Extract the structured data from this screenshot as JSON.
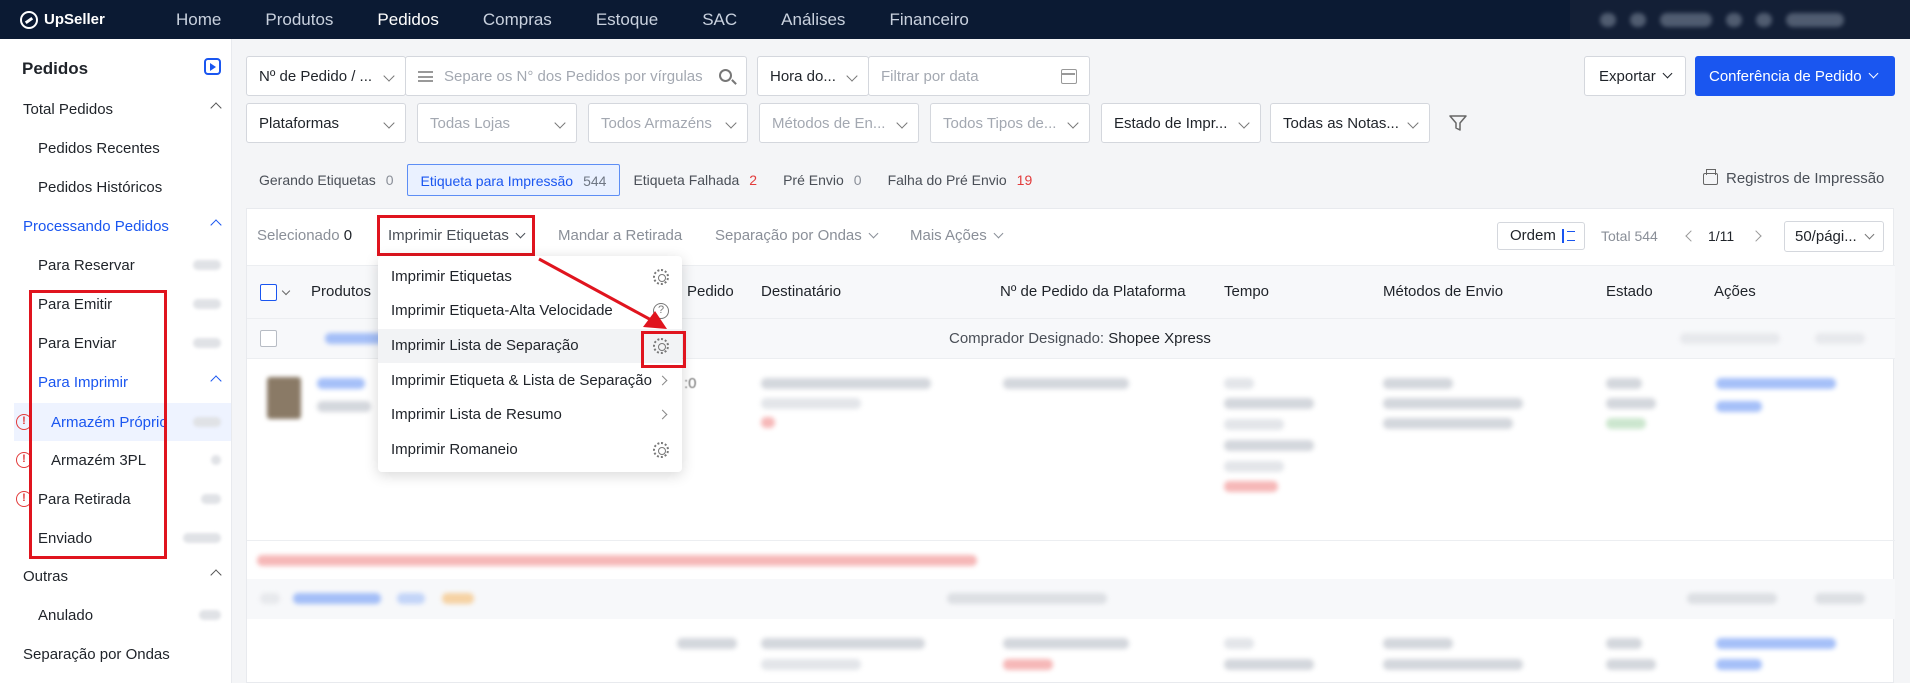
{
  "brand": "UpSeller",
  "nav": [
    "Home",
    "Produtos",
    "Pedidos",
    "Compras",
    "Estoque",
    "SAC",
    "Análises",
    "Financeiro"
  ],
  "sidebar": {
    "title": "Pedidos",
    "items": [
      {
        "label": "Total Pedidos"
      },
      {
        "label": "Pedidos Recentes"
      },
      {
        "label": "Pedidos Históricos"
      },
      {
        "label": "Processando Pedidos"
      },
      {
        "label": "Para Reservar"
      },
      {
        "label": "Para Emitir"
      },
      {
        "label": "Para Enviar"
      },
      {
        "label": "Para Imprimir"
      },
      {
        "label": "Armazém Próprio"
      },
      {
        "label": "Armazém 3PL"
      },
      {
        "label": "Para Retirada"
      },
      {
        "label": "Enviado"
      },
      {
        "label": "Outras"
      },
      {
        "label": "Anulado"
      },
      {
        "label": "Separação por Ondas"
      }
    ]
  },
  "filters": {
    "order_type": "Nº de Pedido / ...",
    "search_placeholder": "Separe os N° dos Pedidos por vírgulas",
    "time_type": "Hora do...",
    "date_placeholder": "Filtrar por data",
    "platforms": "Plataformas",
    "stores": "Todas Lojas",
    "warehouses": "Todos Armazéns",
    "shipping_methods": "Métodos de En...",
    "types": "Todos Tipos de...",
    "print_state": "Estado de Impr...",
    "notes": "Todas as Notas..."
  },
  "actions": {
    "export": "Exportar",
    "conference": "Conferência de Pedido"
  },
  "status_tabs": [
    {
      "label": "Gerando Etiquetas",
      "count": "0"
    },
    {
      "label": "Etiqueta para Impressão",
      "count": "544"
    },
    {
      "label": "Etiqueta Falhada",
      "count": "2"
    },
    {
      "label": "Pré Envio",
      "count": "0"
    },
    {
      "label": "Falha do Pré Envio",
      "count": "19"
    }
  ],
  "print_records": "Registros de Impressão",
  "toolbar": {
    "selected_label": "Selecionado",
    "selected_count": "0",
    "print_labels": "Imprimir Etiquetas",
    "send_pickup": "Mandar a Retirada",
    "wave_picking": "Separação por Ondas",
    "more_actions": "Mais Ações",
    "order": "Ordem",
    "total": "Total 544",
    "page": "1/11",
    "per_page": "50/pági..."
  },
  "table_headers": [
    "Produtos",
    "Pedido",
    "Destinatário",
    "Nº de Pedido da Plataforma",
    "Tempo",
    "Métodos de Envio",
    "Estado",
    "Ações"
  ],
  "group": {
    "label": "Comprador Designado:",
    "carrier": "Shopee Xpress"
  },
  "row": {
    "time_suffix": ":0"
  },
  "dropdown": [
    {
      "label": "Imprimir Etiquetas",
      "icon": "gear-icon"
    },
    {
      "label": "Imprimir Etiqueta-Alta Velocidade",
      "icon": "help-icon"
    },
    {
      "label": "Imprimir Lista de Separação",
      "icon": "gear-icon"
    },
    {
      "label": "Imprimir Etiqueta & Lista de Separação",
      "icon": "chevron-right-icon"
    },
    {
      "label": "Imprimir Lista de Resumo",
      "icon": "chevron-right-icon"
    },
    {
      "label": "Imprimir Romaneio",
      "icon": "gear-icon"
    }
  ],
  "colors": {
    "accent": "#1a56f0",
    "nav_bg": "#0b1a33",
    "highlight": "#e0141e",
    "error": "#e23b3b"
  }
}
